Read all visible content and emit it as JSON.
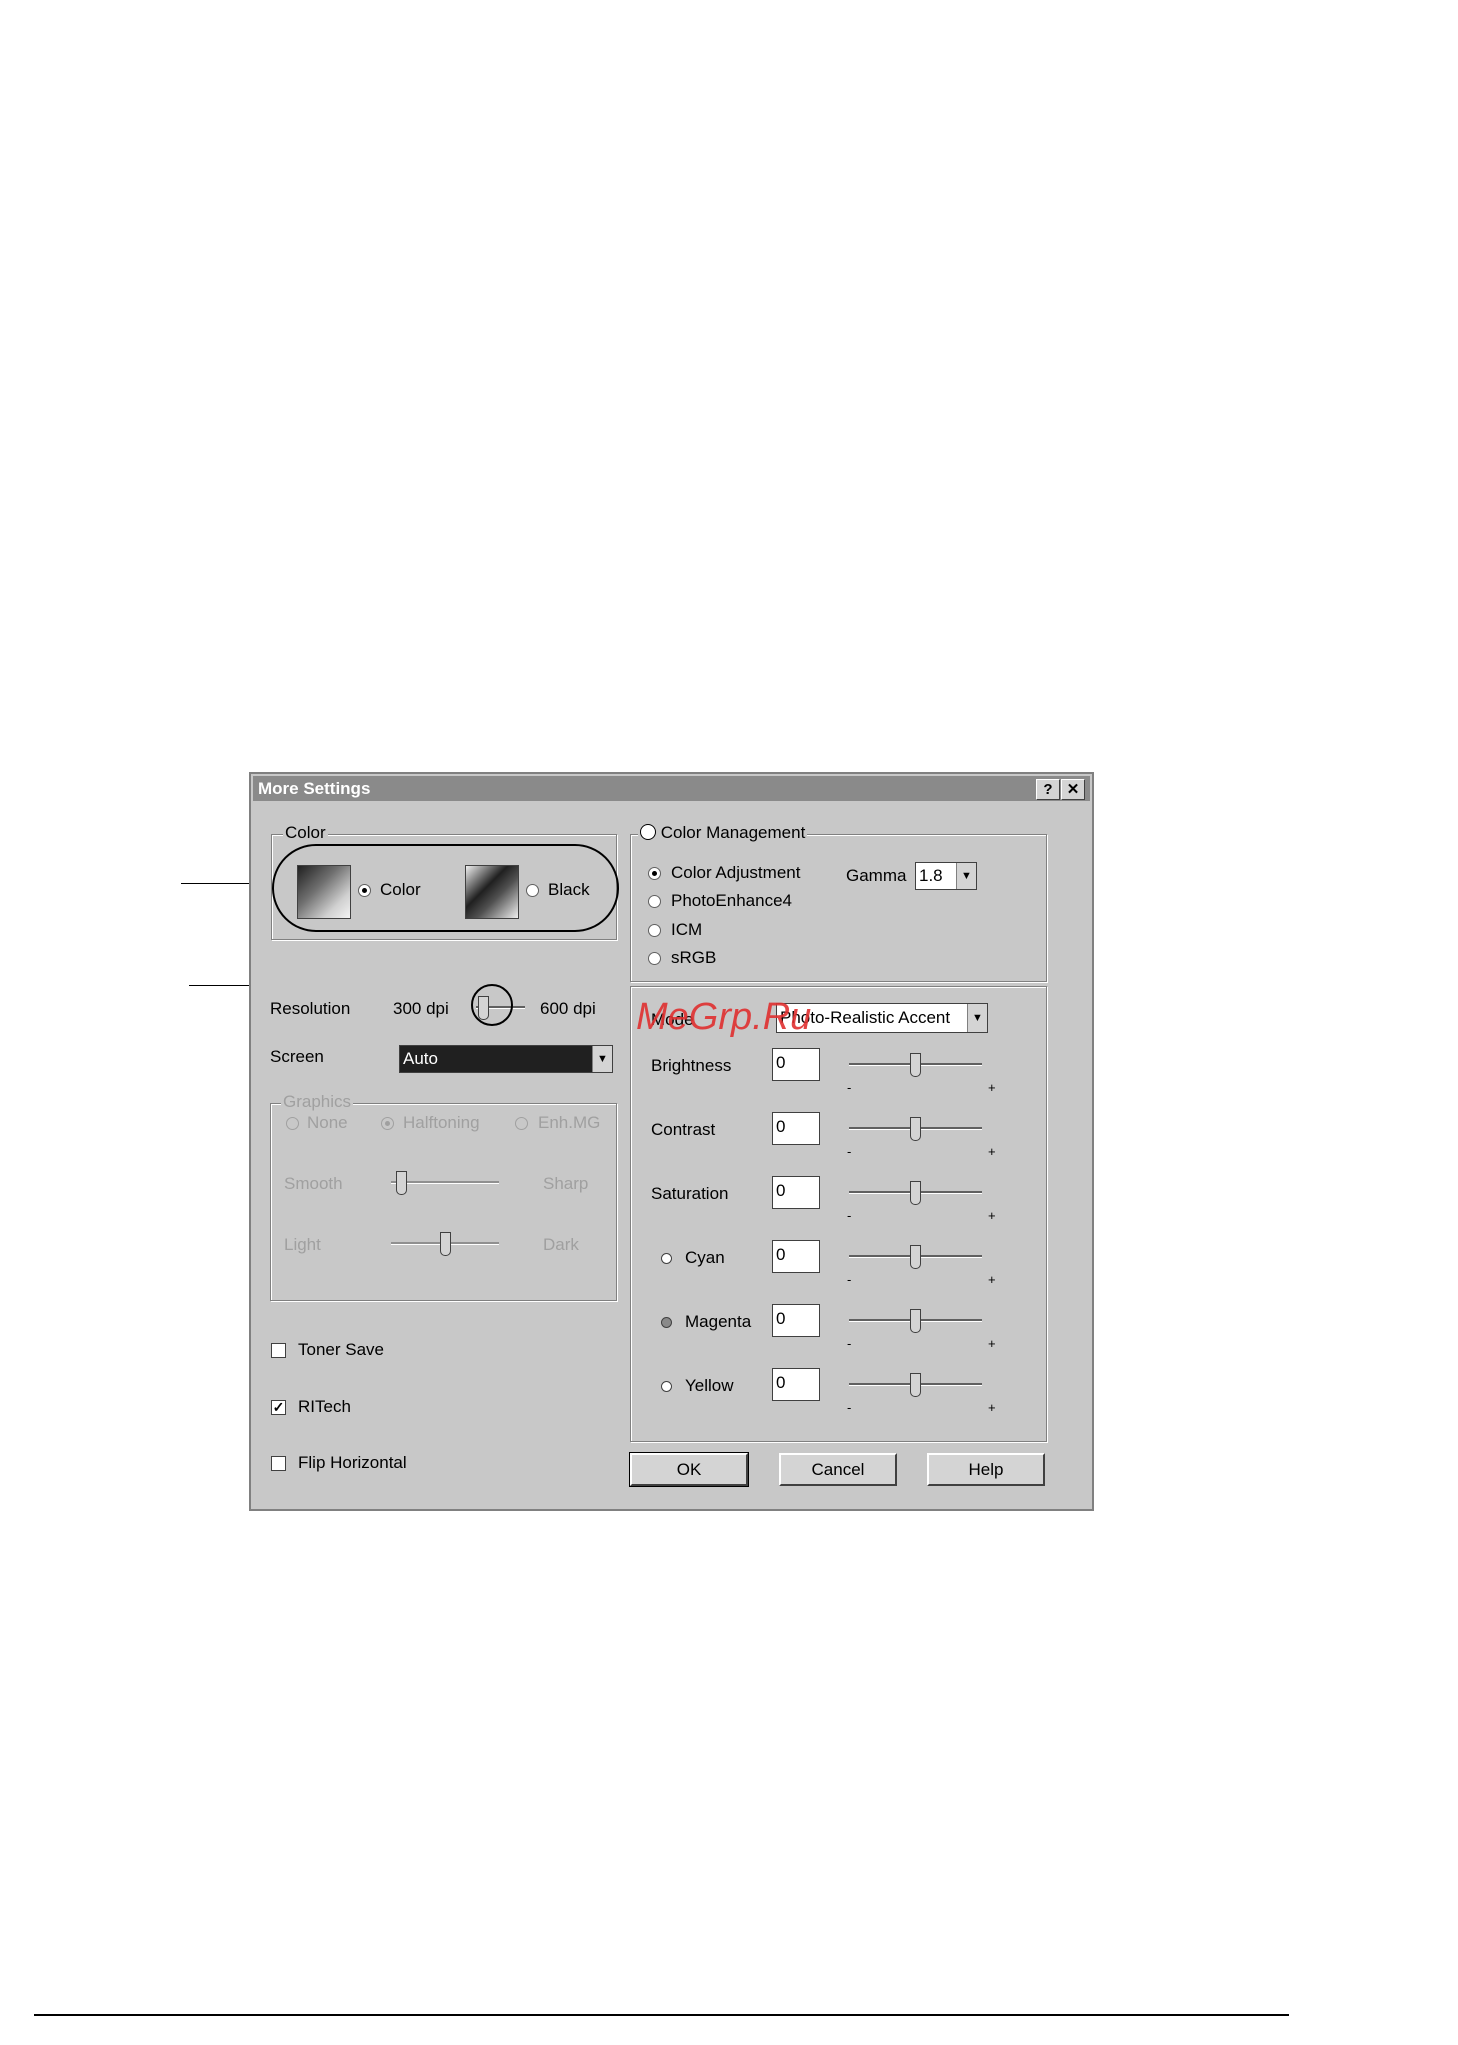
{
  "dialog": {
    "title": "More Settings",
    "help_button": "?",
    "close_button": "✕"
  },
  "color_group": {
    "legend": "Color",
    "options": [
      {
        "label": "Color",
        "selected": true
      },
      {
        "label": "Black",
        "selected": false
      }
    ]
  },
  "resolution": {
    "label": "Resolution",
    "min_label": "300 dpi",
    "max_label": "600 dpi",
    "value_fraction": 0.1
  },
  "screen": {
    "label": "Screen",
    "value": "Auto"
  },
  "graphics": {
    "legend": "Graphics",
    "options": [
      {
        "label": "None",
        "selected": false
      },
      {
        "label": "Halftoning",
        "selected": true
      },
      {
        "label": "Enh.MG",
        "selected": false
      }
    ],
    "smooth_label": "Smooth",
    "sharp_label": "Sharp",
    "light_label": "Light",
    "dark_label": "Dark",
    "smooth_sharp_fraction": 0.05,
    "light_dark_fraction": 0.5
  },
  "checkboxes": [
    {
      "label": "Toner Save",
      "checked": false
    },
    {
      "label": "RITech",
      "checked": true
    },
    {
      "label": "Flip Horizontal",
      "checked": false
    }
  ],
  "color_management": {
    "legend": "Color Management",
    "options": [
      {
        "label": "Color Adjustment",
        "selected": true
      },
      {
        "label": "PhotoEnhance4",
        "selected": false
      },
      {
        "label": "ICM",
        "selected": false
      },
      {
        "label": "sRGB",
        "selected": false
      }
    ],
    "gamma_label": "Gamma",
    "gamma_value": "1.8"
  },
  "adjustment": {
    "mode_label": "Mode",
    "mode_value": "Photo-Realistic Accent",
    "sliders": [
      {
        "label": "Brightness",
        "value": "0",
        "minus": "-",
        "plus": "+",
        "dot": ""
      },
      {
        "label": "Contrast",
        "value": "0",
        "minus": "-",
        "plus": "+",
        "dot": ""
      },
      {
        "label": "Saturation",
        "value": "0",
        "minus": "-",
        "plus": "+",
        "dot": ""
      },
      {
        "label": "Cyan",
        "value": "0",
        "minus": "-",
        "plus": "+",
        "dot": "#ffffff"
      },
      {
        "label": "Magenta",
        "value": "0",
        "minus": "-",
        "plus": "+",
        "dot": "#8a8a8a"
      },
      {
        "label": "Yellow",
        "value": "0",
        "minus": "-",
        "plus": "+",
        "dot": "#ffffff"
      }
    ]
  },
  "buttons": {
    "ok": "OK",
    "cancel": "Cancel",
    "help": "Help"
  },
  "watermark": "MeGrp.Ru"
}
